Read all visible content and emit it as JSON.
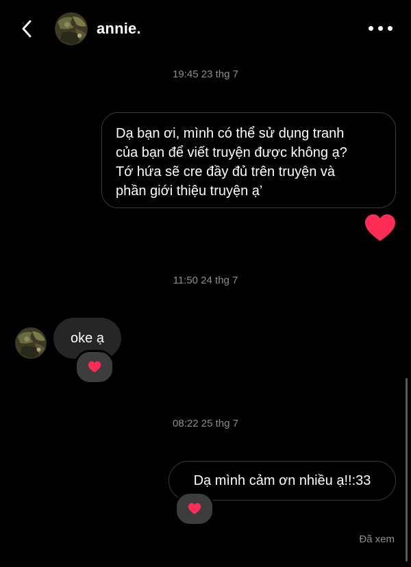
{
  "header": {
    "contact_name": "annie.",
    "back_icon": "chevron-left-icon",
    "more_icon": "more-horizontal-icon"
  },
  "messages": [
    {
      "timestamp": "19:45 23 thg 7",
      "direction": "outgoing",
      "lines": [
        "Dạ bạn ơi, mình có thể sử dụng tranh",
        "của bạn để viết truyện được không ạ?",
        "Tớ hứa sẽ cre đầy đủ trên truyện và",
        "phần giới thiệu truyện ạ’"
      ],
      "reaction": "heart-icon"
    },
    {
      "timestamp": "11:50 24 thg 7",
      "direction": "incoming",
      "text": "oke ạ",
      "reaction": "heart-emoji"
    },
    {
      "timestamp": "08:22 25 thg 7",
      "direction": "outgoing",
      "text": "Dạ mình cảm ơn nhiều ạ!!:33",
      "reaction": "heart-emoji"
    }
  ],
  "status": {
    "seen": "Đã xem"
  },
  "colors": {
    "background": "#000000",
    "incoming_bubble": "#262626",
    "outgoing_border": "#3a3a3a",
    "secondary_text": "#8e8e8e",
    "heart": "#ff2d55"
  }
}
